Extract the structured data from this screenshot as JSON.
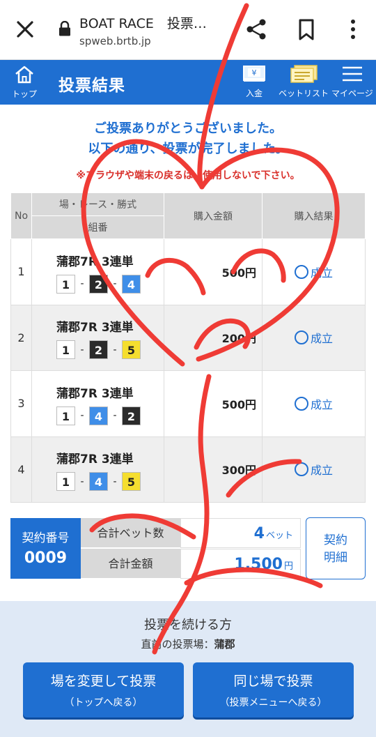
{
  "browser": {
    "title": "BOAT RACE　投票…",
    "url": "spweb.brtb.jp"
  },
  "nav": {
    "home_label": "トップ",
    "page_title": "投票結果",
    "deposit_label": "入金",
    "betlist_label": "ベットリスト",
    "mypage_label": "マイページ"
  },
  "messages": {
    "thanks_line1": "ご投票ありがとうございました。",
    "thanks_line2": "以下の通り、投票が完了しました。",
    "warning": "※ブラウザや端末の戻るは、使用しないで下さい。"
  },
  "table": {
    "headers": {
      "no": "No",
      "race": "場・レース・勝式",
      "combo": "組番",
      "amount": "購入金額",
      "result": "購入結果"
    },
    "rows": [
      {
        "no": "1",
        "race": "蒲郡7R 3連単",
        "boats": [
          "1",
          "2",
          "4"
        ],
        "amount": "500円",
        "result": "成立"
      },
      {
        "no": "2",
        "race": "蒲郡7R 3連単",
        "boats": [
          "1",
          "2",
          "5"
        ],
        "amount": "200円",
        "result": "成立"
      },
      {
        "no": "3",
        "race": "蒲郡7R 3連単",
        "boats": [
          "1",
          "4",
          "2"
        ],
        "amount": "500円",
        "result": "成立"
      },
      {
        "no": "4",
        "race": "蒲郡7R 3連単",
        "boats": [
          "1",
          "4",
          "5"
        ],
        "amount": "300円",
        "result": "成立"
      }
    ],
    "dash": "-"
  },
  "boat_colors": {
    "1": {
      "bg": "#ffffff",
      "fg": "#222222"
    },
    "2": {
      "bg": "#2b2b2b",
      "fg": "#ffffff"
    },
    "3": {
      "bg": "#e8382f",
      "fg": "#ffffff"
    },
    "4": {
      "bg": "#3f8ee8",
      "fg": "#ffffff"
    },
    "5": {
      "bg": "#f5de2f",
      "fg": "#222222"
    },
    "6": {
      "bg": "#2fae4f",
      "fg": "#ffffff"
    }
  },
  "summary": {
    "contract_label": "契約番号",
    "contract_no": "0009",
    "bet_count_label": "合計ベット数",
    "bet_count": "4",
    "bet_unit": "ベット",
    "total_label": "合計金額",
    "total": "1,500",
    "total_unit": "円",
    "detail_line1": "契約",
    "detail_line2": "明細"
  },
  "footer": {
    "continue_text": "投票を続ける方",
    "recent_label": "直前の投票場：",
    "recent_venue": "蒲郡",
    "btn_change_main": "場を変更して投票",
    "btn_change_sub": "（トップへ戻る）",
    "btn_same_main": "同じ場で投票",
    "btn_same_sub": "（投票メニューへ戻る）"
  },
  "colors": {
    "accent": "#1f6fd1",
    "warning": "#d9302b",
    "scribble": "#ef3b35"
  }
}
